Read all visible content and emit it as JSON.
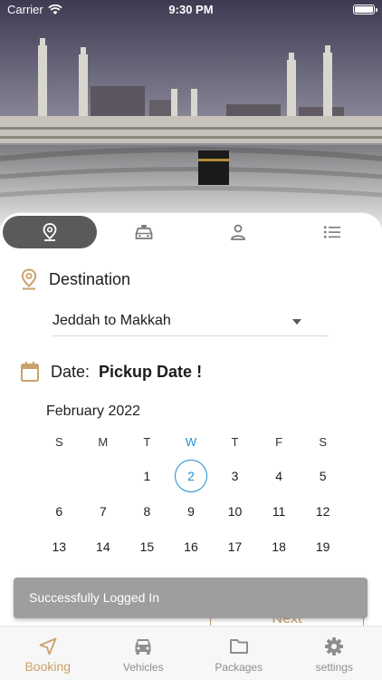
{
  "status_bar": {
    "carrier": "Carrier",
    "time": "9:30 PM"
  },
  "hero": {
    "icon": "kaaba-photo"
  },
  "top_tabs": [
    {
      "icon": "location-pin-icon",
      "active": true
    },
    {
      "icon": "taxi-icon",
      "active": false
    },
    {
      "icon": "person-icon",
      "active": false
    },
    {
      "icon": "list-icon",
      "active": false
    }
  ],
  "destination": {
    "label": "Destination",
    "selected": "Jeddah to Makkah"
  },
  "date": {
    "label": "Date:",
    "value": "Pickup Date !"
  },
  "calendar": {
    "month": "February 2022",
    "weekdays": [
      "S",
      "M",
      "T",
      "W",
      "T",
      "F",
      "S"
    ],
    "weeks": [
      [
        "",
        "",
        "1",
        "2",
        "3",
        "4",
        "5"
      ],
      [
        "6",
        "7",
        "8",
        "9",
        "10",
        "11",
        "12"
      ],
      [
        "13",
        "14",
        "15",
        "16",
        "17",
        "18",
        "19"
      ]
    ],
    "today": "2"
  },
  "next_button": {
    "label": "Next"
  },
  "toast": {
    "message": "Successfully Logged In"
  },
  "bottom_nav": [
    {
      "label": "Booking",
      "icon": "navigation-arrow-icon",
      "active": true
    },
    {
      "label": "Vehicles",
      "icon": "car-icon",
      "active": false
    },
    {
      "label": "Packages",
      "icon": "folder-icon",
      "active": false
    },
    {
      "label": "settings",
      "icon": "gear-icon",
      "active": false
    }
  ],
  "colors": {
    "accent": "#c9a16b",
    "today": "#1f8fd1",
    "toast": "#9e9e9e",
    "tab_active": "#5a5a5a"
  }
}
